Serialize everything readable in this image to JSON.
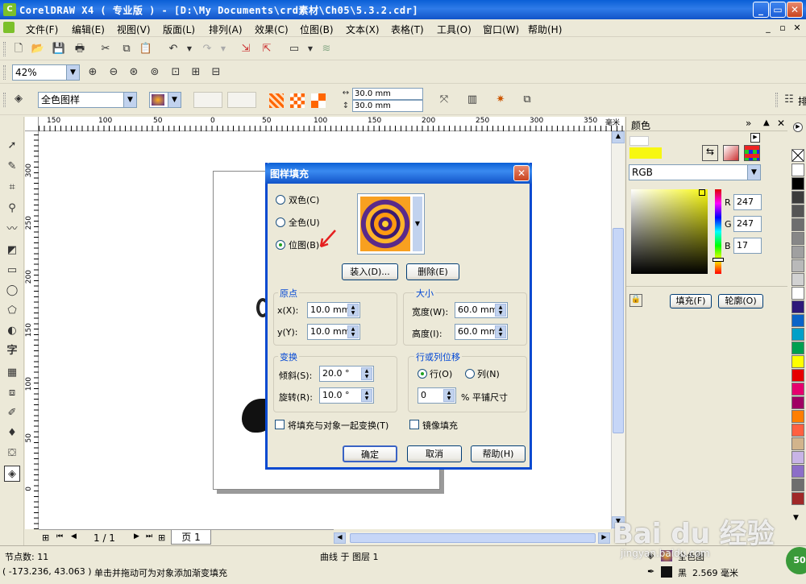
{
  "window": {
    "title": "CorelDRAW X4 ( 专业版 ) - [D:\\My Documents\\crd素材\\Ch05\\5.3.2.cdr]",
    "minimize": "_",
    "restore": "▭",
    "close": "✕"
  },
  "menu": {
    "items": [
      "文件(F)",
      "编辑(E)",
      "视图(V)",
      "版面(L)",
      "排列(A)",
      "效果(C)",
      "位图(B)",
      "文本(X)",
      "表格(T)",
      "工具(O)",
      "窗口(W)",
      "帮助(H)"
    ]
  },
  "toolbar": {
    "zoom": "42%",
    "fill_type": "全色图样",
    "tile_width": "30.0 mm",
    "tile_height": "30.0 mm",
    "right_label": "排"
  },
  "ruler": {
    "unit": "毫米",
    "h_ticks": [
      "150",
      "100",
      "50",
      "0",
      "50",
      "100",
      "150",
      "200",
      "250",
      "300",
      "350"
    ],
    "v_ticks": [
      "300",
      "250",
      "200",
      "150",
      "100",
      "50",
      "0"
    ]
  },
  "page_nav": {
    "counter": "1 / 1",
    "tab": "页 1"
  },
  "docker": {
    "title": "颜色",
    "model": "RGB",
    "r_label": "R",
    "r_value": "247",
    "g_label": "G",
    "g_value": "247",
    "b_label": "B",
    "b_value": "17",
    "fill_button": "填充(F)",
    "outline_button": "轮廓(O)",
    "accent": "#f7f711"
  },
  "palette": {
    "colors": [
      "#ffffff",
      "#000000",
      "#3c3c3c",
      "#555555",
      "#6e6e6e",
      "#878787",
      "#a0a0a0",
      "#b9b9b9",
      "#d2d2d2",
      "#ffffff",
      "#2e1a7a",
      "#0a64c8",
      "#00a0c8",
      "#00a050",
      "#ffff00",
      "#e60000",
      "#e6006e",
      "#a00064",
      "#ff7f00",
      "#ff6040",
      "#d2b48c",
      "#c8b4e6",
      "#8c6ec8",
      "#6e6e6e",
      "#a02828"
    ]
  },
  "status": {
    "nodes": "节点数: 11",
    "layer": "曲线 于 图层 1",
    "coords": "( -173.236, 43.063 )",
    "hint": "单击并拖动可为对象添加渐变填充",
    "fill_name": "全色图",
    "outline_color": "黑",
    "outline_width": "2.569 毫米",
    "badge": "50"
  },
  "dialog": {
    "title": "图样填充",
    "radio_two_color": "双色(C)",
    "radio_full_color": "全色(U)",
    "radio_bitmap": "位图(B)",
    "load_button": "装入(D)...",
    "delete_button": "删除(E)",
    "origin_title": "原点",
    "origin_x_label": "x(X):",
    "origin_x": "10.0 mm",
    "origin_y_label": "y(Y):",
    "origin_y": "10.0 mm",
    "size_title": "大小",
    "width_label": "宽度(W):",
    "width": "60.0 mm",
    "height_label": "高度(I):",
    "height": "60.0 mm",
    "transform_title": "变换",
    "skew_label": "倾斜(S):",
    "skew": "20.0 °",
    "rotate_label": "旋转(R):",
    "rotate": "10.0 °",
    "offset_title": "行或列位移",
    "row_label": "行(O)",
    "col_label": "列(N)",
    "offset_value": "0",
    "offset_unit": "% 平铺尺寸",
    "transform_with_object": "将填充与对象一起变换(T)",
    "mirror_fill": "镜像填充",
    "ok_button": "确定",
    "cancel_button": "取消",
    "help_button": "帮助(H)"
  },
  "watermark": {
    "brand": "Bai du 经验",
    "url": "jingyan.baidu.com"
  }
}
